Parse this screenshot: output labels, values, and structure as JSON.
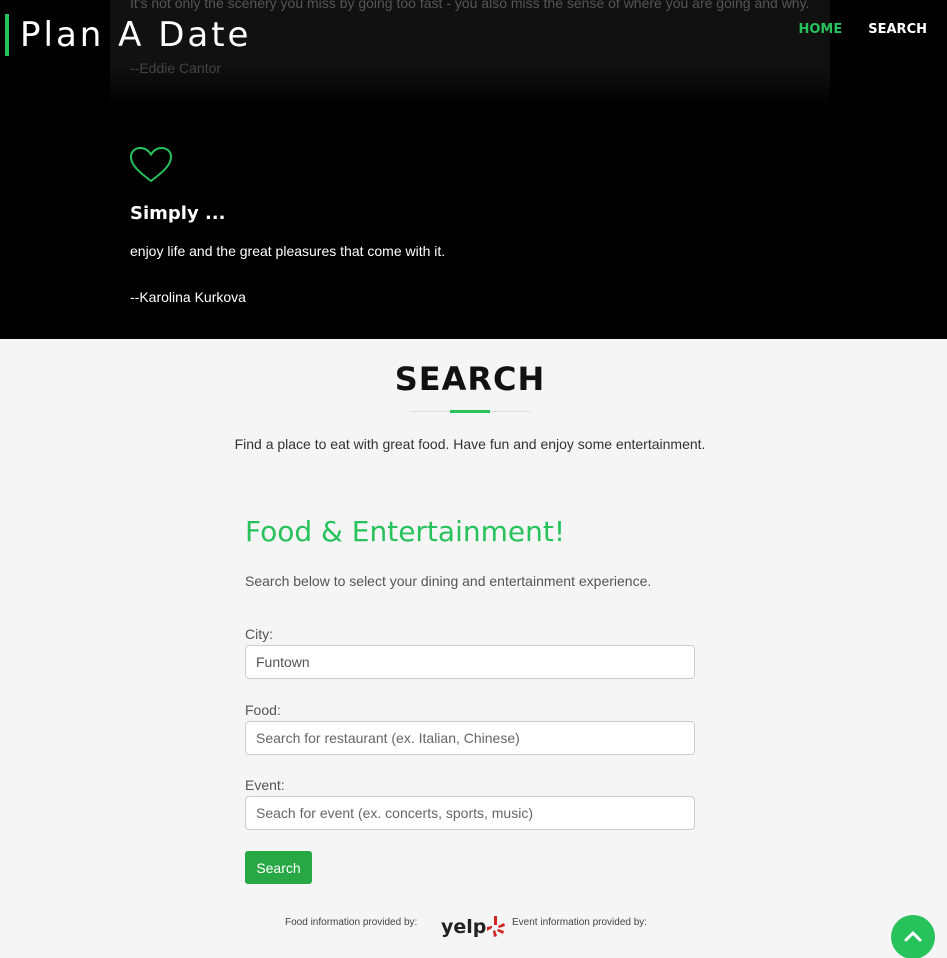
{
  "navbar": {
    "brand": "Plan A Date",
    "links": [
      {
        "label": "HOME",
        "active": true
      },
      {
        "label": "SEARCH",
        "active": false
      }
    ]
  },
  "hero": {
    "previous_quote": {
      "text": "It's not only the scenery you miss by going too fast - you also miss the sense of where you are going and why.",
      "author": "--Eddie Cantor"
    },
    "quote": {
      "icon": "heart-icon",
      "title": "Simply ...",
      "text": "enjoy life and the great pleasures that come with it.",
      "author": "--Karolina Kurkova"
    }
  },
  "search_section": {
    "title": "SEARCH",
    "description": "Find a place to eat with great food. Have fun and enjoy some entertainment.",
    "form": {
      "heading": "Food & Entertainment!",
      "subheading": "Search below to select your dining and entertainment experience.",
      "city": {
        "label": "City:",
        "value": "Funtown"
      },
      "food": {
        "label": "Food:",
        "placeholder": "Search for restaurant (ex. Italian, Chinese)"
      },
      "event": {
        "label": "Event:",
        "placeholder": "Seach for event (ex. concerts, sports, music)"
      },
      "submit_label": "Search"
    },
    "credits": {
      "food": "Food information provided by:",
      "yelp_logo": "yelp",
      "event": "Event information provided by:"
    }
  },
  "colors": {
    "accent": "#27c25c",
    "button": "#27a844",
    "hero_bg": "#000000",
    "page_bg": "#f5f5f5"
  },
  "back_to_top_icon": "chevron-up-icon"
}
